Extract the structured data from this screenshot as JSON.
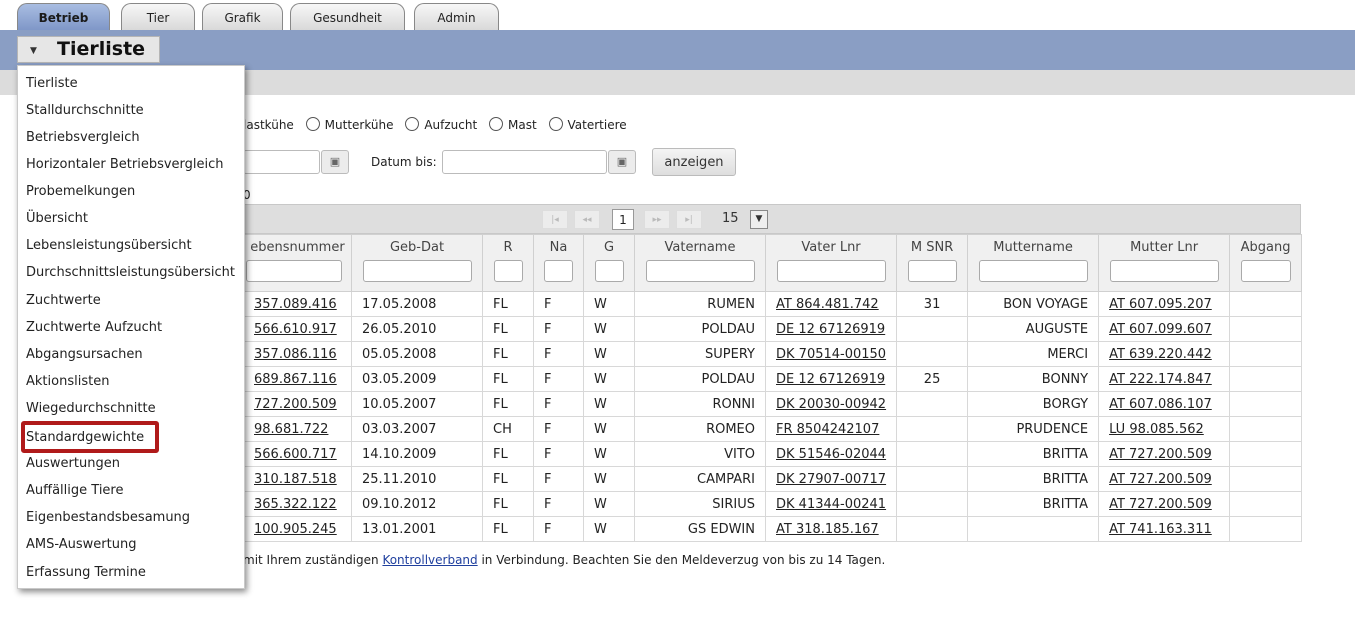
{
  "tabs": [
    "Betrieb",
    "Tier",
    "Grafik",
    "Gesundheit",
    "Admin"
  ],
  "active_tab": "Betrieb",
  "menu": {
    "title": "Tierliste",
    "items": [
      "Tierliste",
      "Stalldurchschnitte",
      "Betriebsvergleich",
      "Horizontaler Betriebsvergleich",
      "Probemelkungen",
      "Übersicht",
      "Lebensleistungsübersicht",
      "Durchschnittsleistungsübersicht",
      "Zuchtwerte",
      "Zuchtwerte Aufzucht",
      "Abgangsursachen",
      "Aktionslisten",
      "Wiegedurchschnitte",
      "Standardgewichte",
      "Auswertungen",
      "Auffällige Tiere",
      "Eigenbestandsbesamung",
      "AMS-Auswertung",
      "Erfassung Termine"
    ],
    "highlighted": "Standardgewichte"
  },
  "filters": {
    "radios": [
      "lastkühe",
      "Mutterkühe",
      "Aufzucht",
      "Mast",
      "Vatertiere"
    ],
    "date_to_label": "Datum bis:",
    "show_button": "anzeigen",
    "truncated_text": "0"
  },
  "pager": {
    "first": "|◂",
    "prev": "◂◂",
    "page": "1",
    "next": "▸▸",
    "last": "▸|",
    "page_size": "15"
  },
  "table": {
    "columns": [
      "ebensnummer",
      "Geb-Dat",
      "R",
      "Na",
      "G",
      "Vatername",
      "Vater Lnr",
      "M SNR",
      "Muttername",
      "Mutter Lnr",
      "Abgang"
    ],
    "rows": [
      [
        "357.089.416",
        "17.05.2008",
        "FL",
        "F",
        "W",
        "RUMEN",
        "AT 864.481.742",
        "31",
        "BON VOYAGE",
        "AT 607.095.207",
        ""
      ],
      [
        "566.610.917",
        "26.05.2010",
        "FL",
        "F",
        "W",
        "POLDAU",
        "DE 12 67126919",
        "",
        "AUGUSTE",
        "AT 607.099.607",
        ""
      ],
      [
        "357.086.116",
        "05.05.2008",
        "FL",
        "F",
        "W",
        "SUPERY",
        "DK 70514-00150",
        "",
        "MERCI",
        "AT 639.220.442",
        ""
      ],
      [
        "689.867.116",
        "03.05.2009",
        "FL",
        "F",
        "W",
        "POLDAU",
        "DE 12 67126919",
        "25",
        "BONNY",
        "AT 222.174.847",
        ""
      ],
      [
        "727.200.509",
        "10.05.2007",
        "FL",
        "F",
        "W",
        "RONNI",
        "DK 20030-00942",
        "",
        "BORGY",
        "AT 607.086.107",
        ""
      ],
      [
        "98.681.722",
        "03.03.2007",
        "CH",
        "F",
        "W",
        "ROMEO",
        "FR 8504242107",
        "",
        "PRUDENCE",
        "LU 98.085.562",
        ""
      ],
      [
        "566.600.717",
        "14.10.2009",
        "FL",
        "F",
        "W",
        "VITO",
        "DK 51546-02044",
        "",
        "BRITTA",
        "AT 727.200.509",
        ""
      ],
      [
        "310.187.518",
        "25.11.2010",
        "FL",
        "F",
        "W",
        "CAMPARI",
        "DK 27907-00717",
        "",
        "BRITTA",
        "AT 727.200.509",
        ""
      ],
      [
        "365.322.122",
        "09.10.2012",
        "FL",
        "F",
        "W",
        "SIRIUS",
        "DK 41344-00241",
        "",
        "BRITTA",
        "AT 727.200.509",
        ""
      ],
      [
        "100.905.245",
        "13.01.2001",
        "FL",
        "F",
        "W",
        "GS EDWIN",
        "AT 318.185.167",
        "",
        "",
        "AT 741.163.311",
        ""
      ]
    ]
  },
  "note": {
    "before": "mit Ihrem zuständigen ",
    "link": "Kontrollverband",
    "after": " in Verbindung. Beachten Sie den Meldeverzug von bis zu 14 Tagen."
  },
  "colors": {
    "header_bar": "#8a9ec4",
    "active_tab": "#8fa5d4",
    "highlight": "#b01a1a"
  }
}
